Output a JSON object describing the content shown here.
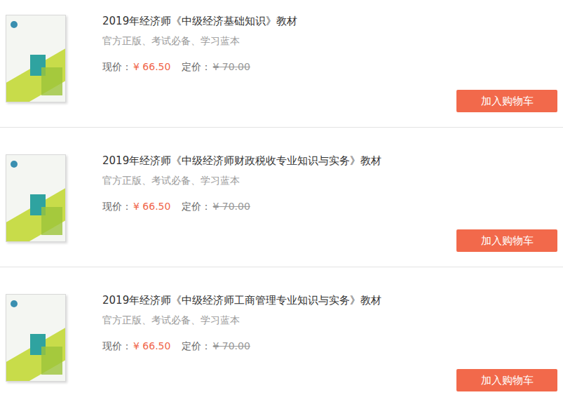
{
  "products": [
    {
      "title": "2019年经济师《中级经济基础知识》教材",
      "subtitle": "官方正版、考试必备、学习蓝本",
      "price_label": "现价：",
      "price": "¥ 66.50",
      "list_label": "定价：",
      "list_price": "¥ 70.00",
      "button": "加入购物车"
    },
    {
      "title": "2019年经济师《中级经济师财政税收专业知识与实务》教材",
      "subtitle": "官方正版、考试必备、学习蓝本",
      "price_label": "现价：",
      "price": "¥ 66.50",
      "list_label": "定价：",
      "list_price": "¥ 70.00",
      "button": "加入购物车"
    },
    {
      "title": "2019年经济师《中级经济师工商管理专业知识与实务》教材",
      "subtitle": "官方正版、考试必备、学习蓝本",
      "price_label": "现价：",
      "price": "¥ 66.50",
      "list_label": "定价：",
      "list_price": "¥ 70.00",
      "button": "加入购物车"
    }
  ]
}
